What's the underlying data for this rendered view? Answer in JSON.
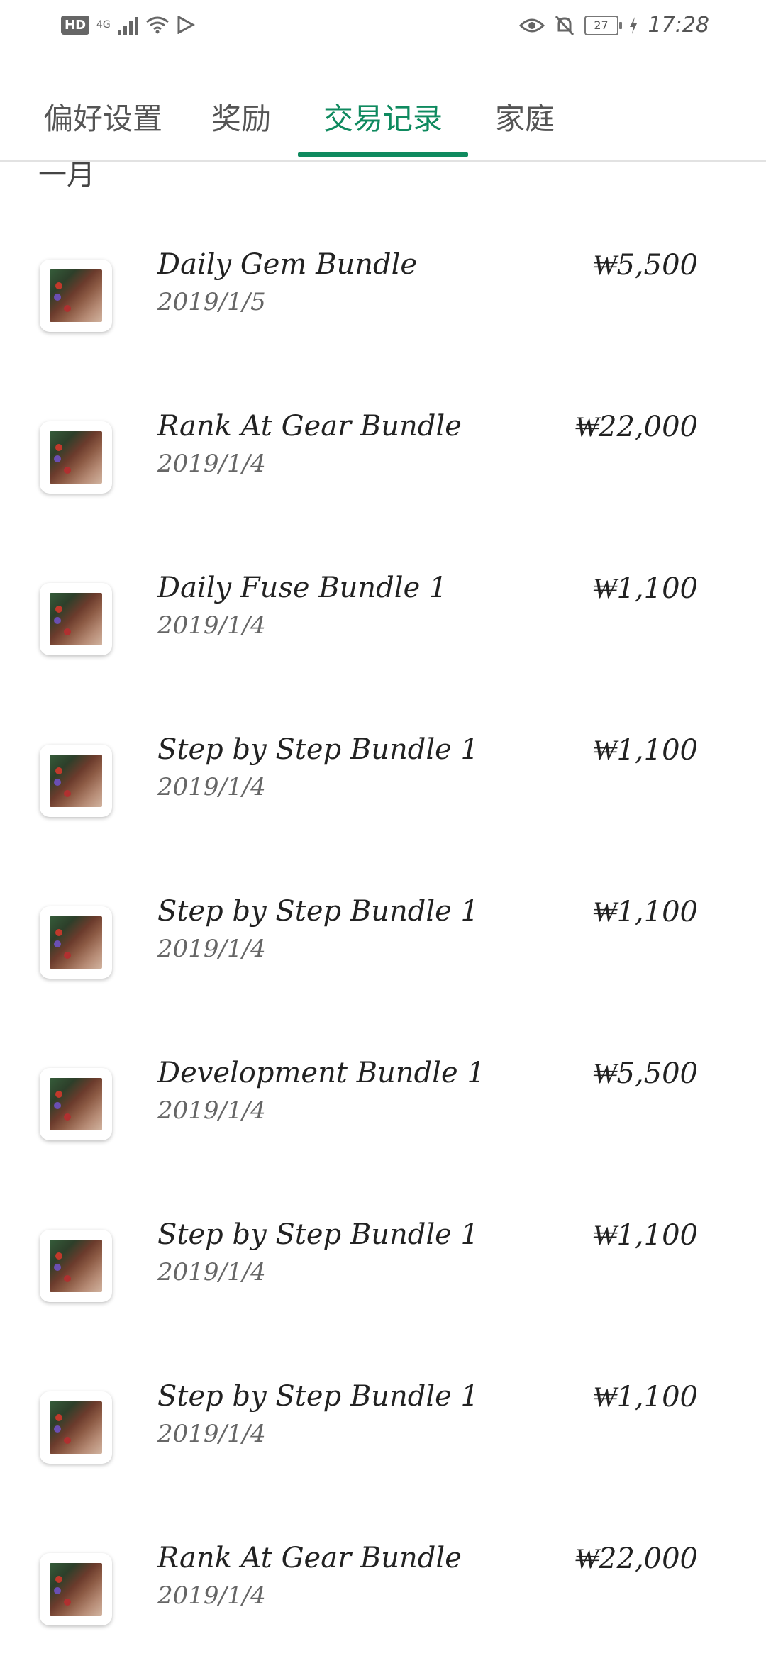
{
  "status_bar": {
    "hd": "HD",
    "network": "4G",
    "battery": "27",
    "time": "17:28"
  },
  "tabs": [
    {
      "label": "偏好设置",
      "active": false
    },
    {
      "label": "奖励",
      "active": false
    },
    {
      "label": "交易记录",
      "active": true
    },
    {
      "label": "家庭",
      "active": false
    }
  ],
  "accent_color": "#0f8a5f",
  "section_label": "一月",
  "transactions": [
    {
      "title": "Daily Gem Bundle",
      "date": "2019/1/5",
      "price": "₩5,500"
    },
    {
      "title": "Rank At Gear Bundle",
      "date": "2019/1/4",
      "price": "₩22,000"
    },
    {
      "title": "Daily Fuse Bundle 1",
      "date": "2019/1/4",
      "price": "₩1,100"
    },
    {
      "title": "Step by Step Bundle 1",
      "date": "2019/1/4",
      "price": "₩1,100"
    },
    {
      "title": "Step by Step Bundle 1",
      "date": "2019/1/4",
      "price": "₩1,100"
    },
    {
      "title": "Development Bundle 1",
      "date": "2019/1/4",
      "price": "₩5,500"
    },
    {
      "title": "Step by Step Bundle 1",
      "date": "2019/1/4",
      "price": "₩1,100"
    },
    {
      "title": "Step by Step Bundle 1",
      "date": "2019/1/4",
      "price": "₩1,100"
    },
    {
      "title": "Rank At Gear Bundle",
      "date": "2019/1/4",
      "price": "₩22,000"
    }
  ]
}
